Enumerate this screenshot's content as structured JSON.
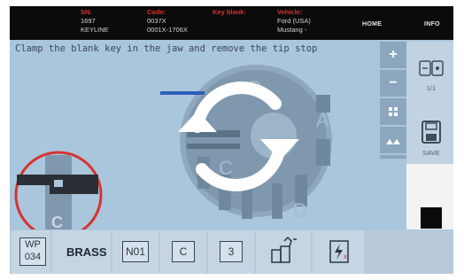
{
  "header": {
    "columns": [
      {
        "label": "SN:",
        "values": [
          "1697",
          "KEYLINE"
        ]
      },
      {
        "label": "Code:",
        "values": [
          "0037X",
          "0001X-1706X"
        ]
      },
      {
        "label": "Key blank:",
        "values": []
      },
      {
        "label": "Vehicle:",
        "values": [
          "Ford (USA)",
          "Mustang -"
        ]
      }
    ],
    "home_label": "HOME",
    "info_label": "INFO"
  },
  "instruction": "Clamp the blank key in the jaw and remove the tip stop",
  "jaw_letters": {
    "top": "B",
    "right": "A",
    "left": "C",
    "bottom": "D"
  },
  "zoom_jaw_letter": "C",
  "toolbar": {
    "zoom_in": "+",
    "zoom_out": "−",
    "fit_icon": "fit-icon",
    "cut_icon": "cut-profile-icon"
  },
  "side": {
    "page": "1/1",
    "save_label": "SAVE"
  },
  "bottom": {
    "wp_top": "WP",
    "wp_bottom": "034",
    "material": "BRASS",
    "n_label": "N01",
    "c_label": "C",
    "num_label": "3"
  },
  "colors": {
    "accent_red": "#d8322f",
    "screen_bg": "#a9c6dd",
    "header_bg": "#0b0b0c"
  }
}
